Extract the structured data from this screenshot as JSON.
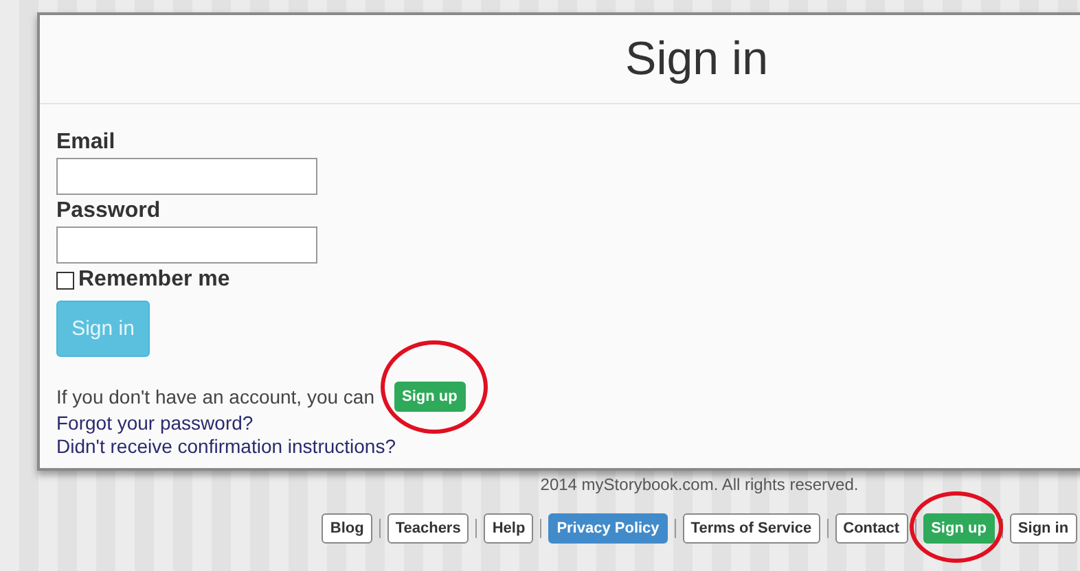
{
  "title": "Sign in",
  "form": {
    "email_label": "Email",
    "password_label": "Password",
    "remember": {
      "label": "Remember me",
      "checked": false
    },
    "submit": "Sign in"
  },
  "links": {
    "signup_text": "If you don't have an account, you can",
    "signup_button": "Sign up",
    "forgot": "Forgot your password?",
    "confirmation": "Didn't receive confirmation instructions?"
  },
  "footer": {
    "copyright": "2014 myStorybook.com. All rights reserved.",
    "links": [
      {
        "label": "Blog",
        "kind": "default"
      },
      {
        "label": "Teachers",
        "kind": "default"
      },
      {
        "label": "Help",
        "kind": "default"
      },
      {
        "label": "Privacy Policy",
        "kind": "primary"
      },
      {
        "label": "Terms of Service",
        "kind": "default"
      },
      {
        "label": "Contact",
        "kind": "default"
      },
      {
        "label": "Sign up",
        "kind": "success"
      },
      {
        "label": "Sign in",
        "kind": "default"
      }
    ]
  }
}
